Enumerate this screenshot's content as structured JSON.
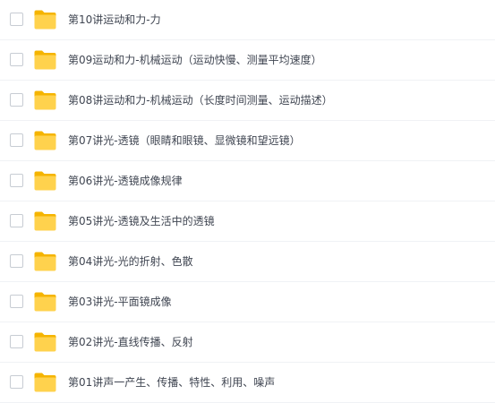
{
  "files": [
    {
      "name": "第10讲运动和力-力",
      "icon": "folder-icon",
      "checked": false
    },
    {
      "name": "第09运动和力-机械运动（运动快慢、测量平均速度）",
      "icon": "folder-icon",
      "checked": false
    },
    {
      "name": "第08讲运动和力-机械运动（长度时间测量、运动描述）",
      "icon": "folder-icon",
      "checked": false
    },
    {
      "name": "第07讲光-透镜（眼睛和眼镜、显微镜和望远镜）",
      "icon": "folder-icon",
      "checked": false
    },
    {
      "name": "第06讲光-透镜成像规律",
      "icon": "folder-icon",
      "checked": false
    },
    {
      "name": "第05讲光-透镜及生活中的透镜",
      "icon": "folder-icon",
      "checked": false
    },
    {
      "name": "第04讲光-光的折射、色散",
      "icon": "folder-icon",
      "checked": false
    },
    {
      "name": "第03讲光-平面镜成像",
      "icon": "folder-icon",
      "checked": false
    },
    {
      "name": "第02讲光-直线传播、反射",
      "icon": "folder-icon",
      "checked": false
    },
    {
      "name": "第01讲声一产生、传播、特性、利用、噪声",
      "icon": "folder-icon",
      "checked": false
    }
  ],
  "colors": {
    "folder_back": "#F5B400",
    "folder_front": "#FFD24D",
    "text": "#404652",
    "divider": "#F0F2F5",
    "checkbox_border": "#C7CCD3"
  }
}
